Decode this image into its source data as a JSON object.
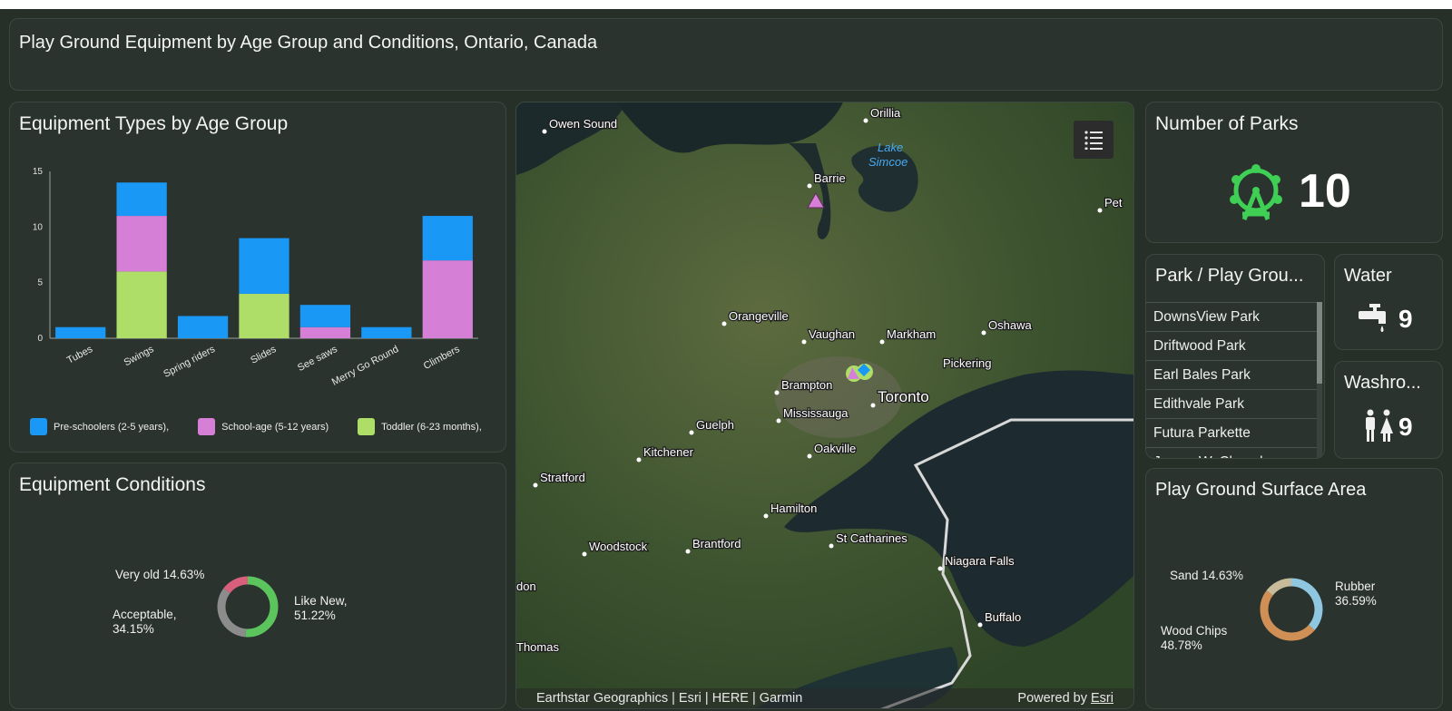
{
  "header": {
    "title": "Play Ground Equipment by Age Group and Conditions, Ontario, Canada"
  },
  "equipment_panel": {
    "title": "Equipment Types by Age Group"
  },
  "conditions_panel": {
    "title": "Equipment Conditions"
  },
  "parks_panel": {
    "title": "Number of Parks",
    "value": "10",
    "icon": "ferris-wheel-icon"
  },
  "list_panel": {
    "title": "Park / Play Grou...",
    "items": [
      "DownsView Park",
      "Driftwood Park",
      "Earl Bales Park",
      "Edithvale Park",
      "Futura Parkette",
      "James W. Chavel..."
    ]
  },
  "water_panel": {
    "title": "Water",
    "value": "9",
    "icon": "faucet-icon"
  },
  "washroom_panel": {
    "title": "Washro...",
    "value": "9",
    "icon": "washroom-icon"
  },
  "surface_panel": {
    "title": "Play Ground Surface Area"
  },
  "map": {
    "attribution": "Earthstar Geographics | Esri | HERE | Garmin",
    "powered_prefix": "Powered by ",
    "powered_link": "Esri",
    "lake_label": [
      "Lake",
      "Simcoe"
    ],
    "places": [
      "Owen Sound",
      "Orillia",
      "Barrie",
      "Pet",
      "Orangeville",
      "Vaughan",
      "Markham",
      "Oshawa",
      "Pickering",
      "Brampton",
      "Toronto",
      "Mississauga",
      "Guelph",
      "Kitchener",
      "Oakville",
      "Stratford",
      "Hamilton",
      "St Catharines",
      "Niagara Falls",
      "Woodstock",
      "Brantford",
      "Buffalo",
      "don",
      "Thomas"
    ]
  },
  "colors": {
    "preschool": "#1a98f5",
    "schoolage": "#d67fd6",
    "toddler": "#aede67",
    "likenew": "#5cc45c",
    "acceptable": "#8c8c8c",
    "veryold": "#d9607c",
    "rubber": "#8fc7e0",
    "woodchips": "#d08f55",
    "sand": "#c8bb99"
  },
  "chart_data": [
    {
      "type": "bar",
      "stacked": true,
      "title": "Equipment Types by Age Group",
      "categories": [
        "Tubes",
        "Swings",
        "Spring riders",
        "Slides",
        "See saws",
        "Merry Go Round",
        "Climbers"
      ],
      "series": [
        {
          "name": "Toddler (6-23 months),",
          "color": "#aede67",
          "values": [
            0,
            6,
            0,
            4,
            0,
            0,
            0
          ]
        },
        {
          "name": "School-age (5-12 years)",
          "color": "#d67fd6",
          "values": [
            0,
            5,
            0,
            0,
            1,
            0,
            7
          ]
        },
        {
          "name": "Pre-schoolers (2-5 years),",
          "color": "#1a98f5",
          "values": [
            1,
            3,
            2,
            5,
            2,
            1,
            4
          ]
        }
      ],
      "ylim": [
        0,
        15
      ],
      "yticks": [
        0,
        5,
        10,
        15
      ],
      "legend": "bottom"
    },
    {
      "type": "pie",
      "donut": true,
      "title": "Equipment Conditions",
      "slices": [
        {
          "label": "Like New,",
          "pct": "51.22%",
          "value": 51.22,
          "color": "#5cc45c"
        },
        {
          "label": "Acceptable,",
          "pct": "34.15%",
          "value": 34.15,
          "color": "#8c8c8c"
        },
        {
          "label": "Very old",
          "pct": "14.63%",
          "value": 14.63,
          "color": "#d9607c"
        }
      ]
    },
    {
      "type": "pie",
      "donut": true,
      "title": "Play Ground Surface Area",
      "slices": [
        {
          "label": "Rubber",
          "pct": "36.59%",
          "value": 36.59,
          "color": "#8fc7e0"
        },
        {
          "label": "Wood Chips",
          "pct": "48.78%",
          "value": 48.78,
          "color": "#d08f55"
        },
        {
          "label": "Sand",
          "pct": "14.63%",
          "value": 14.63,
          "color": "#c8bb99"
        }
      ]
    }
  ]
}
